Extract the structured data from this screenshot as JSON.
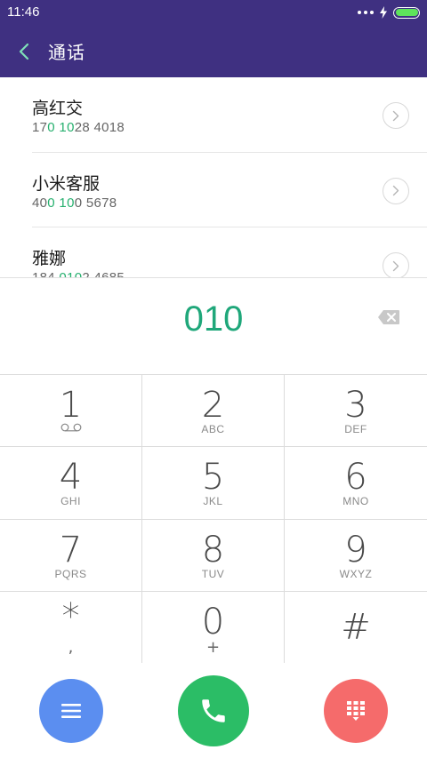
{
  "status_bar": {
    "time": "11:46"
  },
  "header": {
    "title": "通话"
  },
  "contacts": [
    {
      "name": "高红交",
      "number_parts": [
        "17",
        "0",
        " ",
        "10",
        "28 4018"
      ]
    },
    {
      "name": "小米客服",
      "number_parts": [
        "40",
        "0",
        " ",
        "10",
        "0 5678"
      ]
    },
    {
      "name": "雅娜",
      "number_parts": [
        "184 ",
        "010",
        "",
        "",
        "2 4685"
      ]
    }
  ],
  "dial": {
    "number": "010"
  },
  "keypad": [
    {
      "digit": "1",
      "letters": ""
    },
    {
      "digit": "2",
      "letters": "ABC"
    },
    {
      "digit": "3",
      "letters": "DEF"
    },
    {
      "digit": "4",
      "letters": "GHI"
    },
    {
      "digit": "5",
      "letters": "JKL"
    },
    {
      "digit": "6",
      "letters": "MNO"
    },
    {
      "digit": "7",
      "letters": "PQRS"
    },
    {
      "digit": "8",
      "letters": "TUV"
    },
    {
      "digit": "9",
      "letters": "WXYZ"
    },
    {
      "digit": "*",
      "sub": ","
    },
    {
      "digit": "0",
      "sub": "+"
    },
    {
      "digit": "#",
      "sub": ""
    }
  ],
  "colors": {
    "header_bg": "#3f3081",
    "accent_green": "#1fa77a",
    "menu_button": "#5b8ef0",
    "call_button": "#2bbd66",
    "keypad_button": "#f56b6b"
  },
  "icons": {
    "back": "chevron-left-icon",
    "info": "chevron-right-icon",
    "backspace": "backspace-icon",
    "voicemail": "voicemail-icon",
    "menu": "menu-icon",
    "call": "phone-icon",
    "keypad": "keypad-icon"
  }
}
